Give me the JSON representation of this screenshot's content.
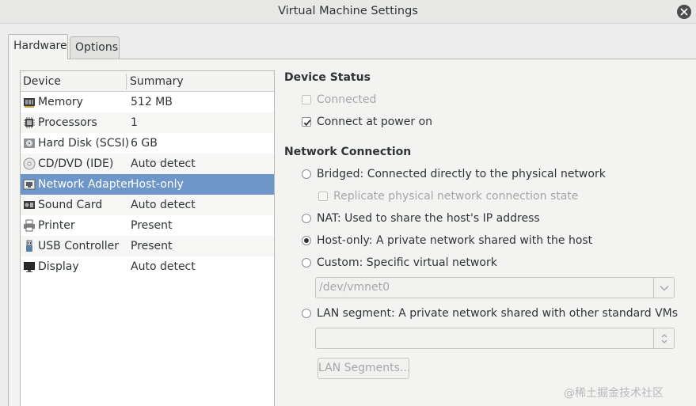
{
  "window": {
    "title": "Virtual Machine Settings"
  },
  "tabs": [
    {
      "label": "Hardware",
      "active": true
    },
    {
      "label": "Options",
      "active": false
    }
  ],
  "device_list": {
    "columns": [
      "Device",
      "Summary"
    ],
    "rows": [
      {
        "device": "Memory",
        "summary": "512 MB",
        "icon": "memory-icon"
      },
      {
        "device": "Processors",
        "summary": "1",
        "icon": "processor-icon"
      },
      {
        "device": "Hard Disk (SCSI)",
        "summary": "6 GB",
        "icon": "hard-disk-icon"
      },
      {
        "device": "CD/DVD (IDE)",
        "summary": "Auto detect",
        "icon": "cd-dvd-icon"
      },
      {
        "device": "Network Adapter",
        "summary": "Host-only",
        "icon": "network-adapter-icon",
        "selected": true
      },
      {
        "device": "Sound Card",
        "summary": "Auto detect",
        "icon": "sound-card-icon"
      },
      {
        "device": "Printer",
        "summary": "Present",
        "icon": "printer-icon"
      },
      {
        "device": "USB Controller",
        "summary": "Present",
        "icon": "usb-controller-icon"
      },
      {
        "device": "Display",
        "summary": "Auto detect",
        "icon": "display-icon"
      }
    ]
  },
  "device_status": {
    "title": "Device Status",
    "connected": {
      "label": "Connected",
      "checked": false,
      "enabled": false
    },
    "connect_at_power_on": {
      "label": "Connect at power on",
      "checked": true,
      "enabled": true
    }
  },
  "network_connection": {
    "title": "Network Connection",
    "bridged": {
      "label": "Bridged: Connected directly to the physical network",
      "selected": false
    },
    "replicate": {
      "label": "Replicate physical network connection state",
      "checked": false,
      "enabled": false
    },
    "nat": {
      "label": "NAT: Used to share the host's IP address",
      "selected": false
    },
    "host_only": {
      "label": "Host-only: A private network shared with the host",
      "selected": true
    },
    "custom": {
      "label": "Custom: Specific virtual network",
      "selected": false
    },
    "custom_network_value": "/dev/vmnet0",
    "lan_segment": {
      "label": "LAN segment: A private network shared with other standard VMs",
      "selected": false
    },
    "lan_segment_value": "",
    "lan_segments_button": "LAN Segments..."
  },
  "watermark": "@稀土掘金技术社区",
  "colors": {
    "selection": "#6e96c8",
    "window_bg": "#ededed",
    "list_bg": "#ffffff"
  }
}
